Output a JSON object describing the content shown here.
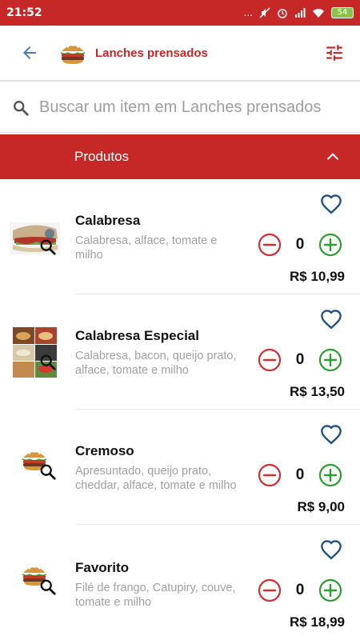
{
  "status_bar": {
    "time": "21:52",
    "dots": "...",
    "battery": "54"
  },
  "header": {
    "title": "Lanches prensados",
    "back_icon": "arrow-left-icon",
    "filter_icon": "sliders-icon",
    "category_image": "burger-image"
  },
  "search": {
    "placeholder": "Buscar um item em Lanches prensados",
    "value": ""
  },
  "section": {
    "title": "Produtos",
    "collapse_icon": "chevron-up-icon"
  },
  "colors": {
    "primary": "#c62828",
    "minus": "#d32f2f",
    "plus": "#2e9e2e",
    "heart": "#1e4f8c"
  },
  "products": [
    {
      "name": "Calabresa",
      "description": "Calabresa, alface, tomate e milho",
      "quantity": "0",
      "price": "R$ 10,99",
      "image": "sandwich-photo"
    },
    {
      "name": "Calabresa Especial",
      "description": "Calabresa, bacon, queijo prato, alface, tomate e milho",
      "quantity": "0",
      "price": "R$ 13,50",
      "image": "sandwich-collage-photo"
    },
    {
      "name": "Cremoso",
      "description": "Apresuntado, queijo prato, cheddar, alface, tomate e milho",
      "quantity": "0",
      "price": "R$ 9,00",
      "image": "burger-image"
    },
    {
      "name": "Favorito",
      "description": "Filé de frango, Catupiry, couve, tomate e milho",
      "quantity": "0",
      "price": "R$ 18,99",
      "image": "burger-image"
    }
  ]
}
